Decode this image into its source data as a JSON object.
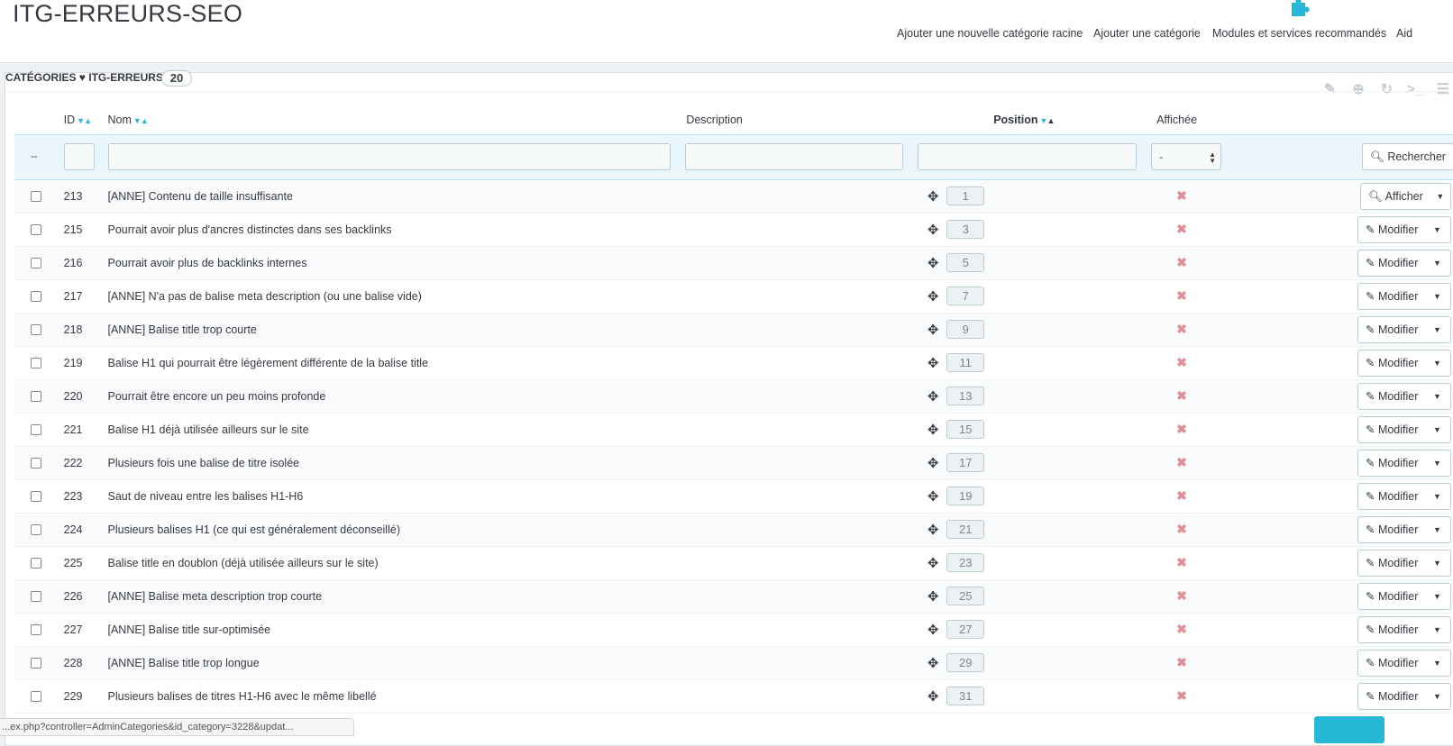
{
  "page_title": "ITG-ERREURS-SEO",
  "toolbar": [
    {
      "label": "Ajouter une nouvelle catégorie racine",
      "icon": "plus-circle-icon"
    },
    {
      "label": "Ajouter une catégorie",
      "icon": "plus-circle-icon"
    },
    {
      "label": "Modules et services recommandés",
      "icon": "puzzle-icon"
    },
    {
      "label": "Aid",
      "icon": "help-icon"
    }
  ],
  "breadcrumb": {
    "root": "CATÉGORIES",
    "separator": "♥",
    "current": "ITG-ERREURS-SEO",
    "count": "20"
  },
  "columns": {
    "id": "ID",
    "name": "Nom",
    "description": "Description",
    "position": "Position",
    "displayed": "Affichée"
  },
  "filter": {
    "bulk": "--",
    "displayed_select": "-",
    "search_button": "Rechercher"
  },
  "rows": [
    {
      "id": "213",
      "name": "[ANNE] Contenu de taille insuffisante",
      "position": "1",
      "action": "Afficher",
      "action_icon": "zoom-icon"
    },
    {
      "id": "215",
      "name": "Pourrait avoir plus d'ancres distinctes dans ses backlinks",
      "position": "3",
      "action": "Modifier",
      "action_icon": "pencil-icon"
    },
    {
      "id": "216",
      "name": "Pourrait avoir plus de backlinks internes",
      "position": "5",
      "action": "Modifier",
      "action_icon": "pencil-icon"
    },
    {
      "id": "217",
      "name": "[ANNE] N'a pas de balise meta description (ou une balise vide)",
      "position": "7",
      "action": "Modifier",
      "action_icon": "pencil-icon"
    },
    {
      "id": "218",
      "name": "[ANNE] Balise title trop courte",
      "position": "9",
      "action": "Modifier",
      "action_icon": "pencil-icon"
    },
    {
      "id": "219",
      "name": "Balise H1 qui pourrait être légèrement différente de la balise title",
      "position": "11",
      "action": "Modifier",
      "action_icon": "pencil-icon"
    },
    {
      "id": "220",
      "name": "Pourrait être encore un peu moins profonde",
      "position": "13",
      "action": "Modifier",
      "action_icon": "pencil-icon"
    },
    {
      "id": "221",
      "name": "Balise H1 déjà utilisée ailleurs sur le site",
      "position": "15",
      "action": "Modifier",
      "action_icon": "pencil-icon"
    },
    {
      "id": "222",
      "name": "Plusieurs fois une balise de titre isolée",
      "position": "17",
      "action": "Modifier",
      "action_icon": "pencil-icon"
    },
    {
      "id": "223",
      "name": "Saut de niveau entre les balises H1-H6",
      "position": "19",
      "action": "Modifier",
      "action_icon": "pencil-icon"
    },
    {
      "id": "224",
      "name": "Plusieurs balises H1 (ce qui est généralement déconseillé)",
      "position": "21",
      "action": "Modifier",
      "action_icon": "pencil-icon"
    },
    {
      "id": "225",
      "name": "Balise title en doublon (déjà utilisée ailleurs sur le site)",
      "position": "23",
      "action": "Modifier",
      "action_icon": "pencil-icon"
    },
    {
      "id": "226",
      "name": "[ANNE] Balise meta description trop courte",
      "position": "25",
      "action": "Modifier",
      "action_icon": "pencil-icon"
    },
    {
      "id": "227",
      "name": "[ANNE] Balise title sur-optimisée",
      "position": "27",
      "action": "Modifier",
      "action_icon": "pencil-icon"
    },
    {
      "id": "228",
      "name": "[ANNE] Balise title trop longue",
      "position": "29",
      "action": "Modifier",
      "action_icon": "pencil-icon"
    },
    {
      "id": "229",
      "name": "Plusieurs balises de titres H1-H6 avec le même libellé",
      "position": "31",
      "action": "Modifier",
      "action_icon": "pencil-icon"
    }
  ],
  "status_url": "...ex.php?controller=AdminCategories&id_category=3228&updat...",
  "colors": {
    "accent": "#25b9d7",
    "disabled_x": "#e08f95"
  }
}
